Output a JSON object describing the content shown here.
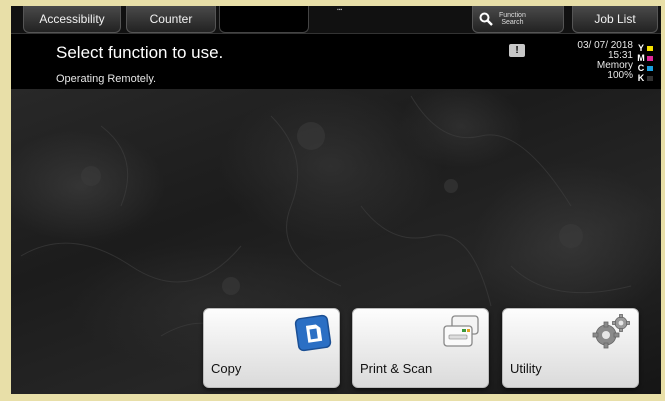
{
  "tabs": {
    "accessibility": "Accessibility",
    "counter": "Counter",
    "function_search_line1": "Function",
    "function_search_line2": "Search",
    "job_list": "Job List"
  },
  "header": {
    "title": "Select function to use.",
    "subtitle": "Operating Remotely.",
    "date": "03/ 07/ 2018",
    "time": "15:31",
    "memory_label": "Memory",
    "memory_value": "100%"
  },
  "toner": [
    {
      "channel": "Y",
      "color": "#f5e000"
    },
    {
      "channel": "M",
      "color": "#e0289a"
    },
    {
      "channel": "C",
      "color": "#1aa0e0"
    },
    {
      "channel": "K",
      "color": "#333333"
    }
  ],
  "tiles": {
    "copy": "Copy",
    "print_scan": "Print & Scan",
    "utility": "Utility"
  },
  "colors": {
    "copy_icon": "#2b6fc4"
  }
}
